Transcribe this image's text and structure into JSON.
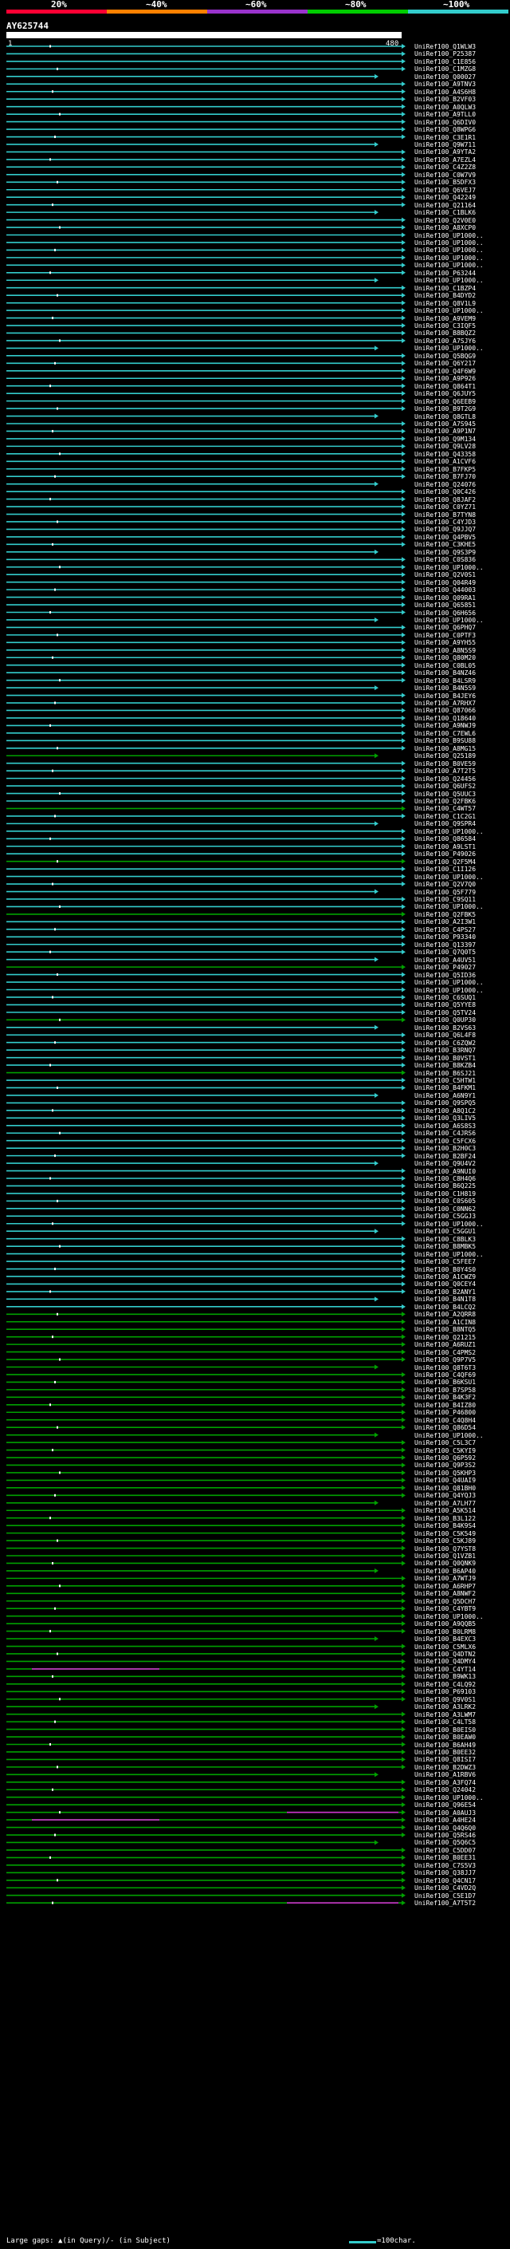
{
  "scale": {
    "labels": [
      "20%",
      "~40%",
      "~60%",
      "~80%",
      "~100%"
    ],
    "colors": [
      "#ff0033",
      "#ff8000",
      "#9933cc",
      "#00cc00",
      "#33cccc"
    ]
  },
  "query": {
    "id": "AY625744",
    "start": "1",
    "end": "480"
  },
  "hits": [
    "UniRef100_Q1WLW3",
    "UniRef100_P25387",
    "UniRef100_C1E856",
    "UniRef100_C1MZG8",
    "UniRef100_Q00027",
    "UniRef100_A9TNV3",
    "UniRef100_A4S6H8",
    "UniRef100_B2VF03",
    "UniRef100_A0QLW3",
    "UniRef100_A9TLL0",
    "UniRef100_Q6DIV0",
    "UniRef100_Q8WPG6",
    "UniRef100_C3E1R1",
    "UniRef100_Q9W711",
    "UniRef100_A9YTA2",
    "UniRef100_A7EZL4",
    "UniRef100_C4Z2Z8",
    "UniRef100_C0W7V9",
    "UniRef100_B5DFX3",
    "UniRef100_Q6VEJ7",
    "UniRef100_Q42249",
    "UniRef100_Q21164",
    "UniRef100_C1BLK6",
    "UniRef100_Q2V0E0",
    "UniRef100_A8XCP0",
    "UniRef100_UP1000..",
    "UniRef100_UP1000..",
    "UniRef100_UP1000..",
    "UniRef100_UP1000..",
    "UniRef100_UP1000..",
    "UniRef100_P63244",
    "UniRef100_UP1000..",
    "UniRef100_C1BZP4",
    "UniRef100_B4DYD2",
    "UniRef100_Q8V1L9",
    "UniRef100_UP1000..",
    "UniRef100_A9VEM9",
    "UniRef100_C3IQF5",
    "UniRef100_B8BQZ2",
    "UniRef100_A7SJY6",
    "UniRef100_UP1000..",
    "UniRef100_Q5BQG9",
    "UniRef100_Q6Y217",
    "UniRef100_Q4F6W9",
    "UniRef100_A9P926",
    "UniRef100_Q864T1",
    "UniRef100_Q6JUY5",
    "UniRef100_Q6EEB9",
    "UniRef100_B9T2G9",
    "UniRef100_Q8GTL8",
    "UniRef100_A7S945",
    "UniRef100_A9P1N7",
    "UniRef100_Q9M134",
    "UniRef100_Q9LV28",
    "UniRef100_Q43358",
    "UniRef100_A1CVF6",
    "UniRef100_B7FKP5",
    "UniRef100_B7FJ70",
    "UniRef100_Q24076",
    "UniRef100_Q0C426",
    "UniRef100_Q8JAF2",
    "UniRef100_C0YZ71",
    "UniRef100_B7TYN8",
    "UniRef100_C4YJD3",
    "UniRef100_Q9JJQ7",
    "UniRef100_Q4PBV5",
    "UniRef100_C3KHE5",
    "UniRef100_Q9S3P9",
    "UniRef100_C0S836",
    "UniRef100_UP1000..",
    "UniRef100_Q2V0S1",
    "UniRef100_Q04R49",
    "UniRef100_Q44003",
    "UniRef100_Q09RA1",
    "UniRef100_Q65851",
    "UniRef100_Q6H656",
    "UniRef100_UP1000..",
    "UniRef100_Q6PHQ7",
    "UniRef100_C0PTF3",
    "UniRef100_A9YH55",
    "UniRef100_A8N5S9",
    "UniRef100_Q80M20",
    "UniRef100_C0BL05",
    "UniRef100_B4NZ46",
    "UniRef100_B4LSR9",
    "UniRef100_B4N5S9",
    "UniRef100_B4JEY6",
    "UniRef100_A7RHX7",
    "UniRef100_Q87066",
    "UniRef100_Q18640",
    "UniRef100_A9NWJ9",
    "UniRef100_C7EWL6",
    "UniRef100_B9SU88",
    "UniRef100_A8MG15",
    "UniRef100_Q25189",
    "UniRef100_B0VE59",
    "UniRef100_A7T2T5",
    "UniRef100_Q24456",
    "UniRef100_Q6UFS2",
    "UniRef100_Q5UUC3",
    "UniRef100_Q2FBK6",
    "UniRef100_C4WT57",
    "UniRef100_C1C2G1",
    "UniRef100_Q9SPR4",
    "UniRef100_UP1000..",
    "UniRef100_Q86584",
    "UniRef100_A9LST1",
    "UniRef100_P49026",
    "UniRef100_Q2F5M4",
    "UniRef100_C1I126",
    "UniRef100_UP1000..",
    "UniRef100_Q2V7Q0",
    "UniRef100_Q5F779",
    "UniRef100_C9SQ11",
    "UniRef100_UP1000..",
    "UniRef100_Q2FBK5",
    "UniRef100_A2I3W1",
    "UniRef100_C4PS27",
    "UniRef100_P93340",
    "UniRef100_Q13397",
    "UniRef100_Q7Q0T5",
    "UniRef100_A4UV51",
    "UniRef100_P49027",
    "UniRef100_Q5ID36",
    "UniRef100_UP1000..",
    "UniRef100_UP1000..",
    "UniRef100_C6SUQ1",
    "UniRef100_Q5YYE8",
    "UniRef100_Q5TV24",
    "UniRef100_Q0UP30",
    "UniRef100_B2VS63",
    "UniRef100_Q6L4F8",
    "UniRef100_C6ZQW2",
    "UniRef100_B3RNQ7",
    "UniRef100_B0VST1",
    "UniRef100_B8KZB4",
    "UniRef100_B6SJ21",
    "UniRef100_C5HTW1",
    "UniRef100_B4FKM1",
    "UniRef100_A6N9Y1",
    "UniRef100_Q9SPQ5",
    "UniRef100_A8Q1C2",
    "UniRef100_Q3LIV5",
    "UniRef100_A6S8S3",
    "UniRef100_C4JRS6",
    "UniRef100_C5FCX6",
    "UniRef100_B2H0C3",
    "UniRef100_B2BF24",
    "UniRef100_Q9U4V2",
    "UniRef100_A9NUI0",
    "UniRef100_C8H4Q6",
    "UniRef100_B6Q225",
    "UniRef100_C1H819",
    "UniRef100_C0S605",
    "UniRef100_C0NN62",
    "UniRef100_C5GGJ3",
    "UniRef100_UP1000..",
    "UniRef100_C5GGU1",
    "UniRef100_C8BLK3",
    "UniRef100_B8MBK5",
    "UniRef100_UP1000..",
    "UniRef100_C5FEE7",
    "UniRef100_B0Y4S0",
    "UniRef100_A1CWZ9",
    "UniRef100_Q0CEY4",
    "UniRef100_B2ANY1",
    "UniRef100_B4N1T8",
    "UniRef100_B4LCQ2",
    "UniRef100_A2QRR8",
    "UniRef100_A1CIN8",
    "UniRef100_B8NTQ5",
    "UniRef100_Q21215",
    "UniRef100_A6RUZ1",
    "UniRef100_C4PMS2",
    "UniRef100_Q9P7V5",
    "UniRef100_Q8T6T3",
    "UniRef100_C4QF69",
    "UniRef100_B6KSU1",
    "UniRef100_B7SP58",
    "UniRef100_B4K3F2",
    "UniRef100_B4IZ80",
    "UniRef100_P46800",
    "UniRef100_C4Q8H4",
    "UniRef100_Q86D54",
    "UniRef100_UP1000..",
    "UniRef100_C5L3C7",
    "UniRef100_C5KYI9",
    "UniRef100_Q6P592",
    "UniRef100_Q9P3S2",
    "UniRef100_Q5KHP3",
    "UniRef100_Q4UAI9",
    "UniRef100_Q81BH0",
    "UniRef100_Q4YQJ3",
    "UniRef100_A7LH77",
    "UniRef100_A5K514",
    "UniRef100_B3L122",
    "UniRef100_B4K9S4",
    "UniRef100_C5K549",
    "UniRef100_C5KJ89",
    "UniRef100_Q7YST8",
    "UniRef100_Q1VZB1",
    "UniRef100_Q0QNK9",
    "UniRef100_B6AP40",
    "UniRef100_A7WTJ9",
    "UniRef100_A6RHP7",
    "UniRef100_A8NWF2",
    "UniRef100_Q5DCH7",
    "UniRef100_C4YBT9",
    "UniRef100_UP1000..",
    "UniRef100_A9QQB5",
    "UniRef100_B0LRM8",
    "UniRef100_B4EXC3",
    "UniRef100_C5MLX6",
    "UniRef100_Q4DTN2",
    "UniRef100_Q4DMY4",
    "UniRef100_C4YT14",
    "UniRef100_B9WK13",
    "UniRef100_C4LQ92",
    "UniRef100_P69103",
    "UniRef100_Q9V0S1",
    "UniRef100_A3LRK2",
    "UniRef100_A3LWM7",
    "UniRef100_C4LT58",
    "UniRef100_B0EIS0",
    "UniRef100_B0EAW0",
    "UniRef100_B6AH49",
    "UniRef100_B0EE32",
    "UniRef100_Q8ISI7",
    "UniRef100_B2DWZ3",
    "UniRef100_A1RBV6",
    "UniRef100_A3FQ74",
    "UniRef100_Q24042",
    "UniRef100_UP1000..",
    "UniRef100_Q96E54",
    "UniRef100_A0AUJ3",
    "UniRef100_A4HE24",
    "UniRef100_Q4Q6Q0",
    "UniRef100_Q5RS46",
    "UniRef100_Q5Q6C5",
    "UniRef100_C5DD07",
    "UniRef100_B0EE31",
    "UniRef100_C7S5V3",
    "UniRef100_Q38JJ7",
    "UniRef100_Q4CN17",
    "UniRef100_C4VD2Q",
    "UniRef100_C5E1D7",
    "UniRef100_A7T5T2"
  ],
  "footer": {
    "large_gaps_label": "Large gaps: ▲(in Query)/- (in Subject)",
    "scale_label": "=100char."
  },
  "colors": {
    "cyan": "#33cccc",
    "green": "#00a000",
    "magenta": "#cc33cc",
    "dark": "#000000",
    "white": "#ffffff"
  }
}
